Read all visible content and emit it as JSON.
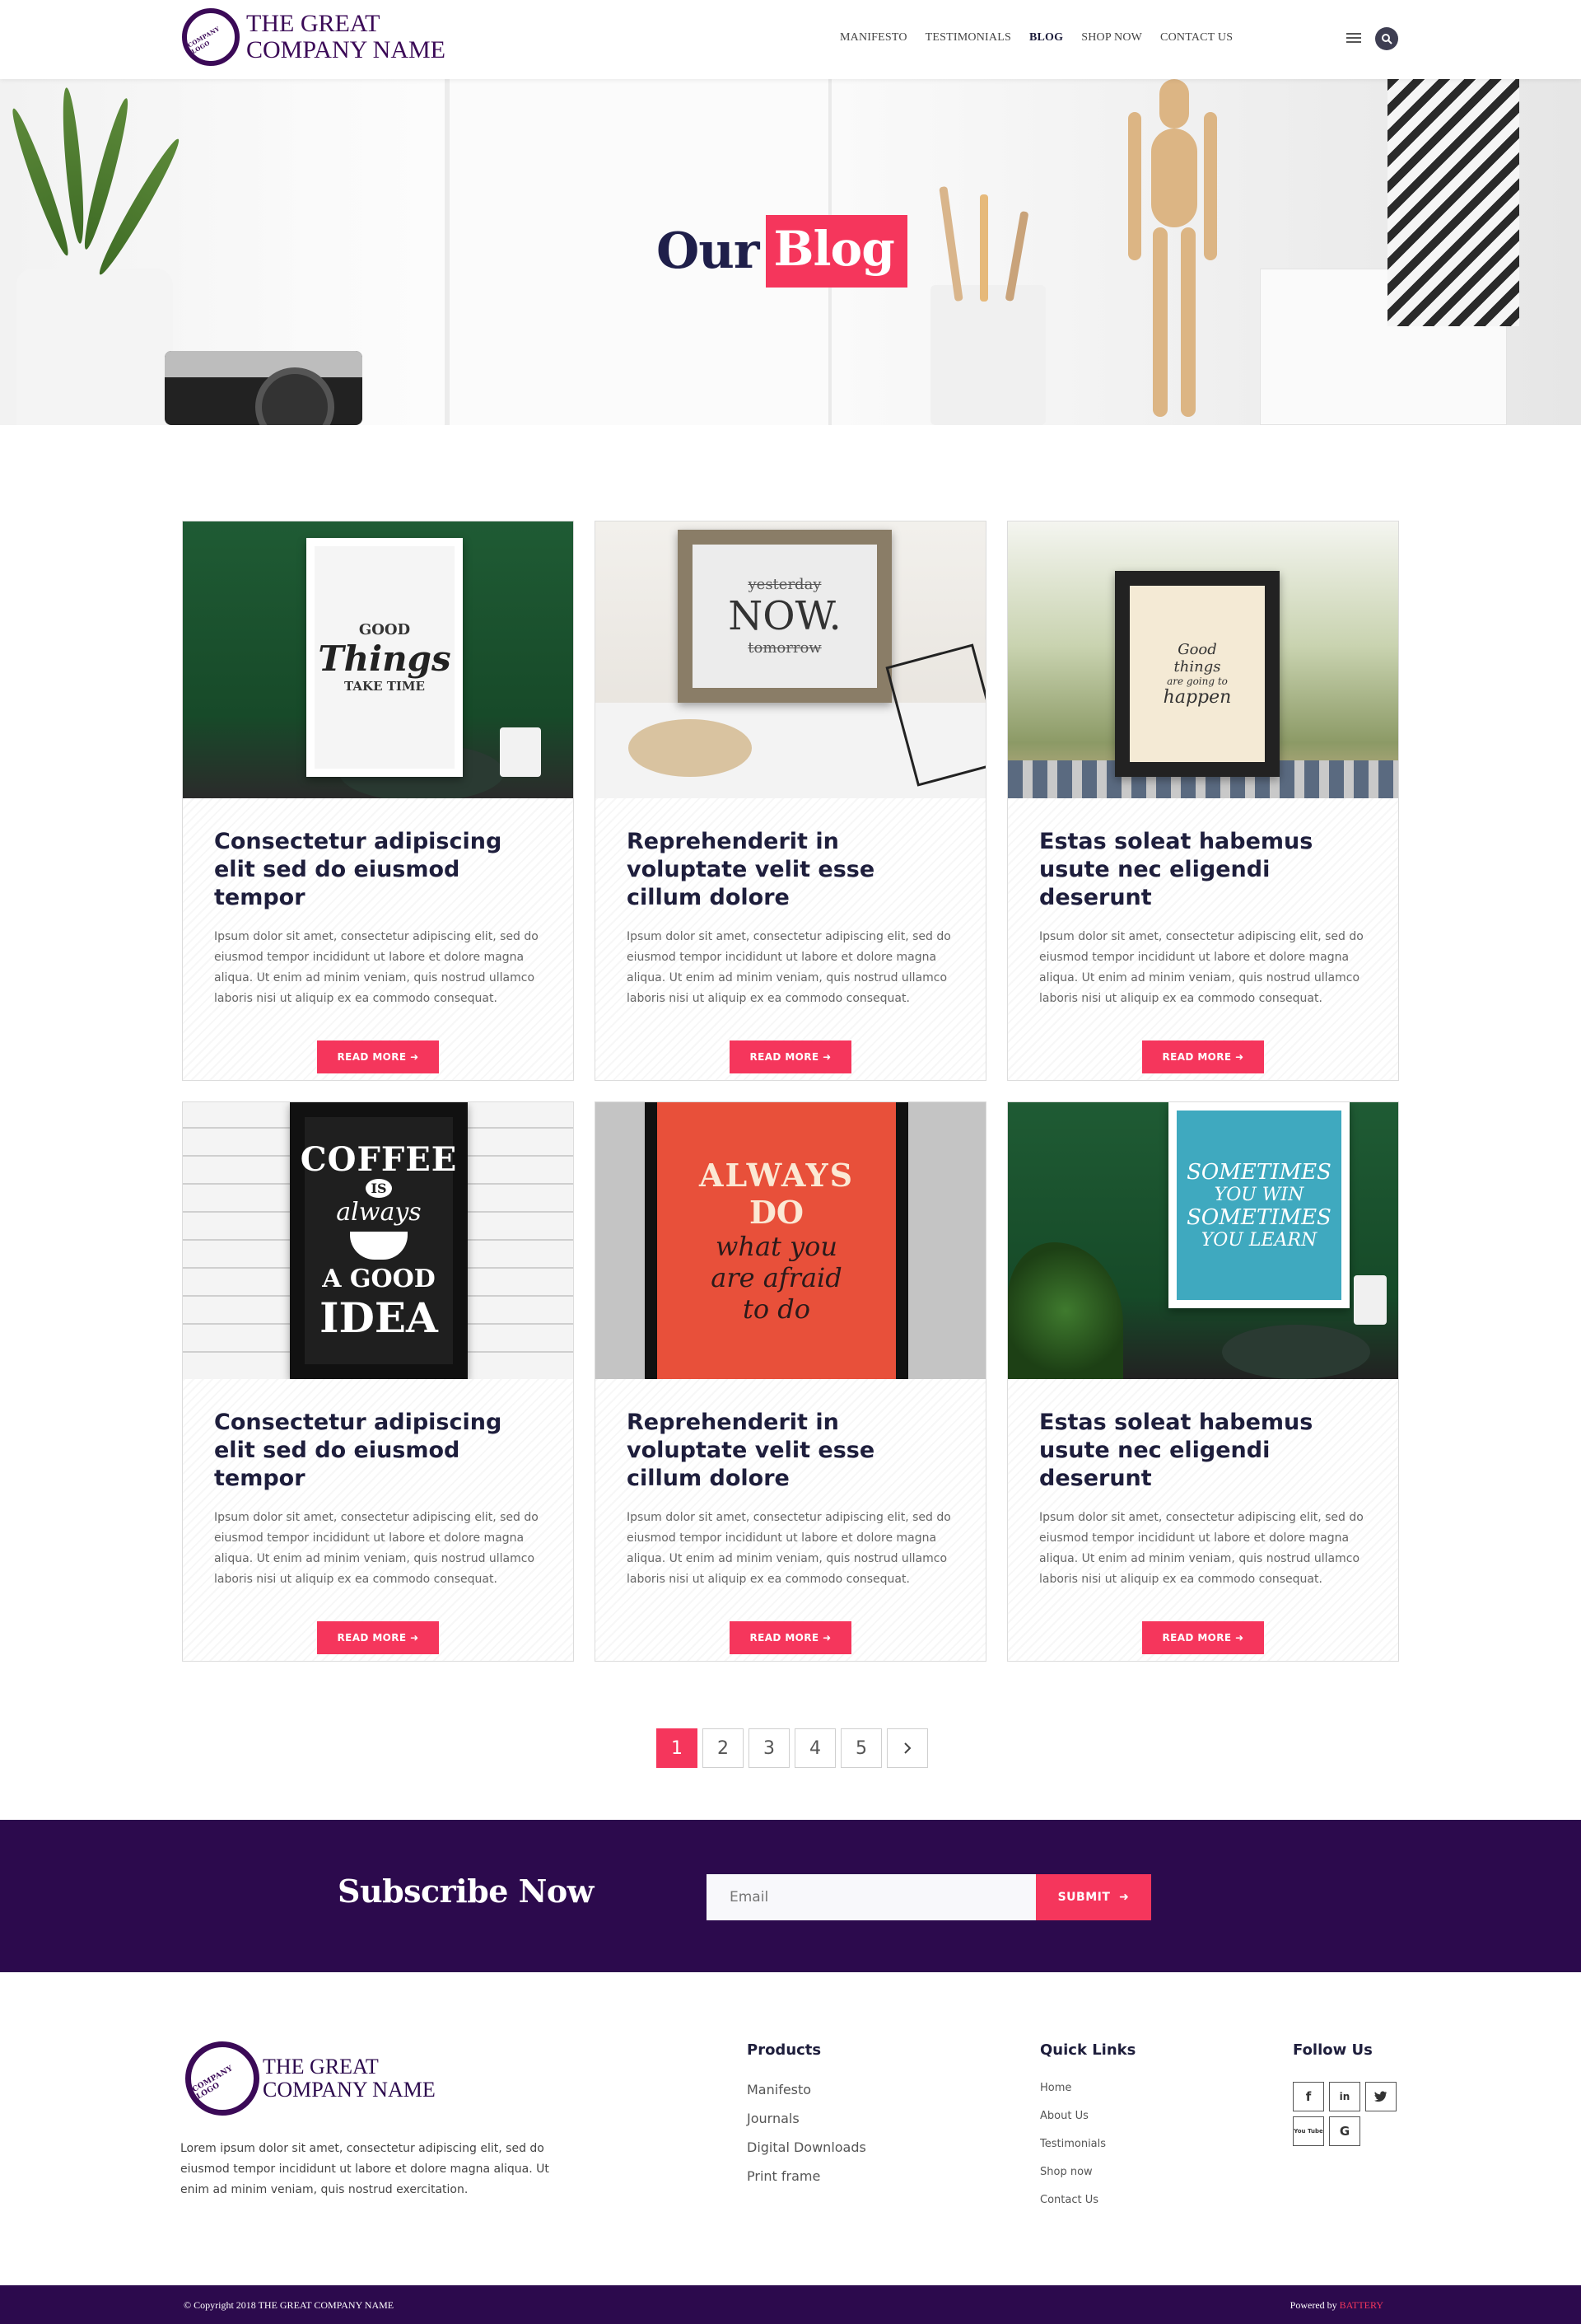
{
  "header": {
    "logo_badge": "COMPANY LOGO",
    "logo_line1": "THE GREAT",
    "logo_line2": "COMPANY NAME",
    "nav": [
      "MANIFESTO",
      "TESTIMONIALS",
      "BLOG",
      "SHOP NOW",
      "CONTACT US"
    ],
    "active_nav": "BLOG"
  },
  "hero": {
    "title_part1": "Our",
    "title_part2": "Blog"
  },
  "posts": [
    {
      "title": "Consectetur adipiscing elit sed do eiusmod tempor",
      "excerpt": "Ipsum dolor sit amet, consectetur adipiscing elit, sed do eiusmod tempor incididunt ut labore et dolore magna aliqua. Ut enim ad minim veniam, quis nostrud ullamco laboris nisi ut aliquip ex ea commodo consequat.",
      "button": "READ MORE",
      "poster": [
        "GOOD",
        "Things",
        "TAKE TIME"
      ]
    },
    {
      "title": "Reprehenderit in voluptate velit esse cillum dolore",
      "excerpt": "Ipsum dolor sit amet, consectetur adipiscing elit, sed do eiusmod tempor incididunt ut labore et dolore magna aliqua. Ut enim ad minim veniam, quis nostrud ullamco laboris nisi ut aliquip ex ea commodo consequat.",
      "button": "READ MORE",
      "poster": [
        "yesterday",
        "NOW.",
        "tomorrow"
      ]
    },
    {
      "title": "Estas soleat habemus usute nec eligendi deserunt",
      "excerpt": "Ipsum dolor sit amet, consectetur adipiscing elit, sed do eiusmod tempor incididunt ut labore et dolore magna aliqua. Ut enim ad minim veniam, quis nostrud ullamco laboris nisi ut aliquip ex ea commodo consequat.",
      "button": "READ MORE",
      "poster": [
        "Good",
        "things",
        "are going to",
        "happen"
      ]
    },
    {
      "title": "Consectetur adipiscing elit sed do eiusmod tempor",
      "excerpt": "Ipsum dolor sit amet, consectetur adipiscing elit, sed do eiusmod tempor incididunt ut labore et dolore magna aliqua. Ut enim ad minim veniam, quis nostrud ullamco laboris nisi ut aliquip ex ea commodo consequat.",
      "button": "READ MORE",
      "poster": [
        "COFFEE",
        "IS",
        "always",
        "A GOOD",
        "IDEA"
      ]
    },
    {
      "title": "Reprehenderit in voluptate velit esse cillum dolore",
      "excerpt": "Ipsum dolor sit amet, consectetur adipiscing elit, sed do eiusmod tempor incididunt ut labore et dolore magna aliqua. Ut enim ad minim veniam, quis nostrud ullamco laboris nisi ut aliquip ex ea commodo consequat.",
      "button": "READ MORE",
      "poster": [
        "ALWAYS",
        "DO",
        "what you",
        "are afraid",
        "to do"
      ]
    },
    {
      "title": "Estas soleat habemus usute nec eligendi deserunt",
      "excerpt": "Ipsum dolor sit amet, consectetur adipiscing elit, sed do eiusmod tempor incididunt ut labore et dolore magna aliqua. Ut enim ad minim veniam, quis nostrud ullamco laboris nisi ut aliquip ex ea commodo consequat.",
      "button": "READ MORE",
      "poster": [
        "SOMETIMES",
        "YOU WIN",
        "SOMETIMES",
        "YOU LEARN"
      ]
    }
  ],
  "pagination": {
    "pages": [
      "1",
      "2",
      "3",
      "4",
      "5"
    ],
    "current": "1",
    "next_icon": "chevron-right-icon"
  },
  "subscribe": {
    "title": "Subscribe Now",
    "placeholder": "Email",
    "button": "SUBMIT"
  },
  "footer": {
    "logo_badge": "COMPANY LOGO",
    "logo_line1": "THE GREAT",
    "logo_line2": "COMPANY NAME",
    "about": "Lorem ipsum dolor sit amet, consectetur adipiscing elit, sed do eiusmod tempor incididunt ut labore et dolore magna aliqua. Ut enim ad minim veniam, quis nostrud exercitation.",
    "products_title": "Products",
    "products": [
      "Manifesto",
      "Journals",
      "Digital Downloads",
      "Print frame"
    ],
    "quick_title": "Quick Links",
    "quick": [
      "Home",
      "About Us",
      "Testimonials",
      "Shop now",
      "Contact Us"
    ],
    "follow_title": "Follow Us",
    "socials": [
      "f",
      "in",
      "twitter",
      "You Tube",
      "G"
    ]
  },
  "bottom": {
    "copyright": "© Copyright 2018 THE GREAT COMPANY NAME",
    "powered_by": "Powered by",
    "brand": "BATTERY"
  },
  "colors": {
    "accent": "#f5365c",
    "brand": "#2c0a4d",
    "title": "#1e1e3c"
  }
}
